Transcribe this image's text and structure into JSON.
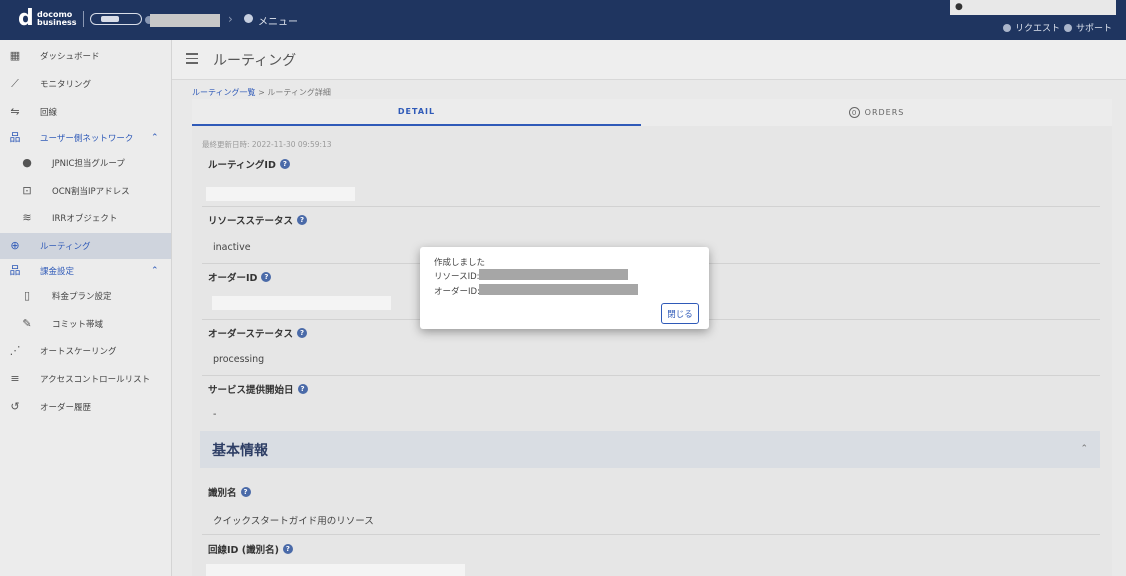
{
  "header": {
    "logo_text_line1": "docomo",
    "logo_text_line2": "business",
    "menu_label": "メニュー",
    "request_label": "リクエスト",
    "support_label": "サポート"
  },
  "sidebar": {
    "items": [
      {
        "label": "ダッシュボード",
        "icon": "dashboard-icon"
      },
      {
        "label": "モニタリング",
        "icon": "chart-icon"
      },
      {
        "label": "回線",
        "icon": "line-icon"
      },
      {
        "label": "ユーザー側ネットワーク",
        "icon": "network-icon"
      },
      {
        "label": "JPNIC担当グループ",
        "icon": "person-icon"
      },
      {
        "label": "OCN割当IPアドレス",
        "icon": "computer-icon"
      },
      {
        "label": "IRRオブジェクト",
        "icon": "database-icon"
      },
      {
        "label": "ルーティング",
        "icon": "routing-icon"
      },
      {
        "label": "課金設定",
        "icon": "billing-icon"
      },
      {
        "label": "料金プラン設定",
        "icon": "document-icon"
      },
      {
        "label": "コミット帯域",
        "icon": "pen-icon"
      },
      {
        "label": "オートスケーリング",
        "icon": "autoscale-icon"
      },
      {
        "label": "アクセスコントロールリスト",
        "icon": "list-check-icon"
      },
      {
        "label": "オーダー履歴",
        "icon": "history-icon"
      }
    ]
  },
  "page": {
    "title": "ルーティング",
    "breadcrumb_link": "ルーティング一覧",
    "breadcrumb_sep": ">",
    "breadcrumb_current": "ルーティング詳細",
    "tab_detail": "DETAIL",
    "tab_orders_count": "0",
    "tab_orders": "ORDERS",
    "updated": "最終更新日時: 2022-11-30 09:59:13"
  },
  "fields": {
    "routing_id_label": "ルーティングID",
    "resource_status_label": "リソースステータス",
    "resource_status_value": "inactive",
    "order_id_label": "オーダーID",
    "order_status_label": "オーダーステータス",
    "order_status_value": "processing",
    "service_start_label": "サービス提供開始日",
    "service_start_value": "-"
  },
  "section": {
    "title": "基本情報",
    "name_label": "識別名",
    "name_value": "クイックスタートガイド用のリソース",
    "line_id_label": "回線ID (識別名)"
  },
  "dialog": {
    "line1": "作成しました",
    "line2_prefix": "リソースID:",
    "line3_prefix": "オーダーID:",
    "close_label": "閉じる"
  }
}
